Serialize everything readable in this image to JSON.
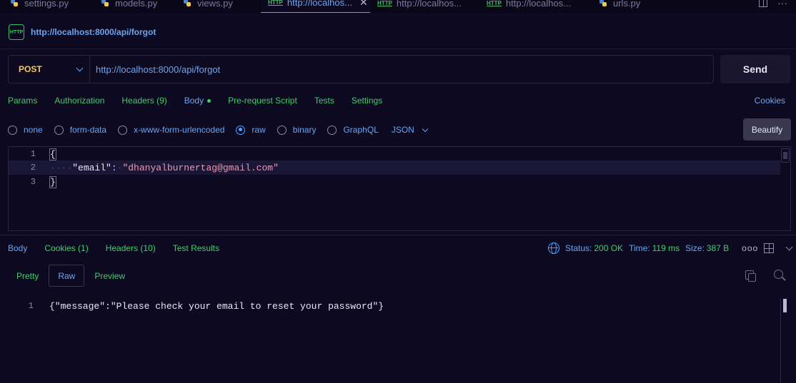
{
  "tabs": [
    {
      "label": "settings.py",
      "type": "py"
    },
    {
      "label": "models.py",
      "type": "py"
    },
    {
      "label": "views.py",
      "type": "py"
    },
    {
      "label": "http://localhos...",
      "type": "http",
      "active": true
    },
    {
      "label": "http://localhos...",
      "type": "http"
    },
    {
      "label": "http://localhos...",
      "type": "http"
    },
    {
      "label": "urls.py",
      "type": "py"
    }
  ],
  "header": {
    "badge": "HTTP",
    "title": "http://localhost:8000/api/forgot"
  },
  "request": {
    "method": "POST",
    "url": "http://localhost:8000/api/forgot",
    "send_label": "Send"
  },
  "request_tabs": {
    "params": "Params",
    "authorization": "Authorization",
    "headers": "Headers (9)",
    "body": "Body",
    "prerequest": "Pre-request Script",
    "tests": "Tests",
    "settings": "Settings",
    "cookies": "Cookies"
  },
  "body_types": {
    "none": "none",
    "form_data": "form-data",
    "urlencoded": "x-www-form-urlencoded",
    "raw": "raw",
    "binary": "binary",
    "graphql": "GraphQL",
    "format": "JSON",
    "selected": "raw",
    "beautify": "Beautify"
  },
  "editor": {
    "lines": [
      {
        "num": "1",
        "text": "{"
      },
      {
        "num": "2",
        "key": "\"email\"",
        "value": "\"dhanyalburnertag@gmail.com\""
      },
      {
        "num": "3",
        "text": "}"
      }
    ]
  },
  "response_tabs": {
    "body": "Body",
    "cookies": "Cookies (1)",
    "headers": "Headers (10)",
    "tests": "Test Results"
  },
  "status": {
    "status_label": "Status:",
    "status_value": "200 OK",
    "time_label": "Time:",
    "time_value": "119 ms",
    "size_label": "Size:",
    "size_value": "387 B",
    "more": "ooo"
  },
  "view_tabs": {
    "pretty": "Pretty",
    "raw": "Raw",
    "preview": "Preview",
    "selected": "Raw"
  },
  "response": {
    "line_num": "1",
    "body": "{\"message\":\"Please check your email to reset your password\"}"
  },
  "colors": {
    "accent": "#4aa3ff",
    "green": "#3fcf6a",
    "method": "#f4c95d",
    "background": "#0d0920"
  }
}
